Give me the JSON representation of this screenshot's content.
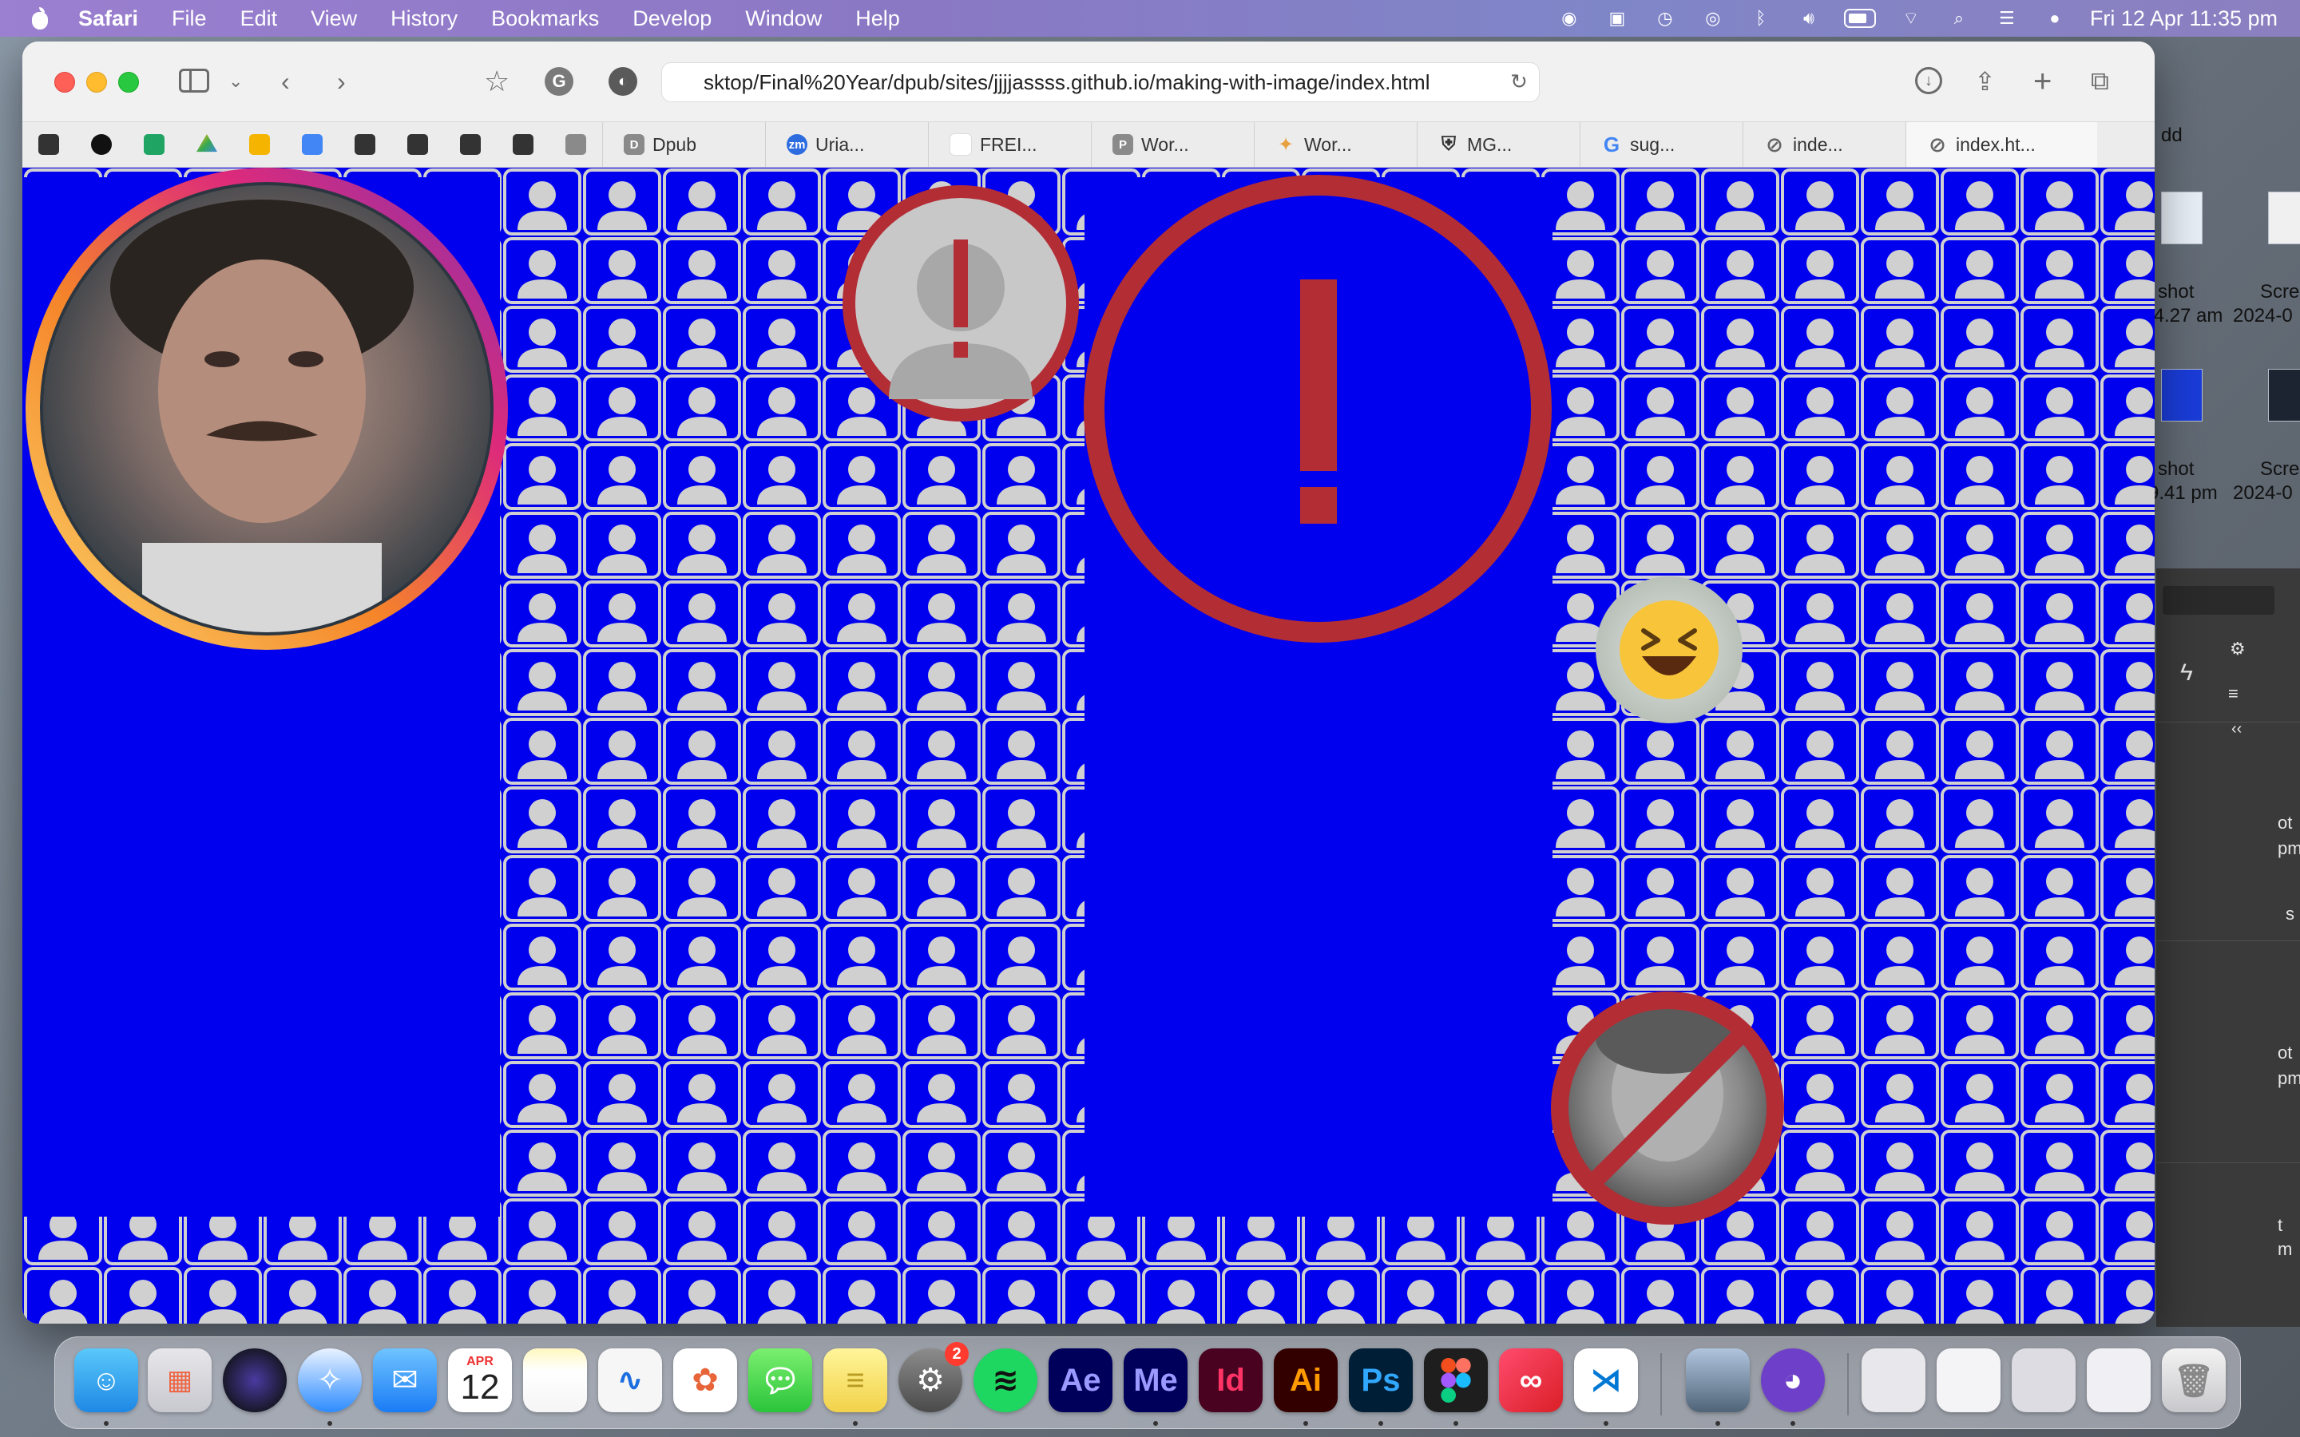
{
  "menubar": {
    "app_name": "Safari",
    "menus": [
      "File",
      "Edit",
      "View",
      "History",
      "Bookmarks",
      "Develop",
      "Window",
      "Help"
    ],
    "clock": "Fri 12 Apr  11:35 pm"
  },
  "browser": {
    "url": "sktop/Final%20Year/dpub/sites/jjjjassss.github.io/making-with-image/index.html",
    "favorites": [
      {
        "label": "Dpub",
        "icon_letter": "D",
        "color": "#8a8a8a"
      },
      {
        "label": "Uria...",
        "icon_letter": "zm",
        "color": "#2d6cdf"
      },
      {
        "label": "FREI...",
        "icon_letter": "",
        "color": "#ffffff"
      },
      {
        "label": "Wor...",
        "icon_letter": "P",
        "color": "#8a8a8a"
      },
      {
        "label": "Wor...",
        "icon_letter": "✦",
        "color": "#e8a040"
      },
      {
        "label": "MG...",
        "icon_letter": "⛨",
        "color": "#333333"
      },
      {
        "label": "sug...",
        "icon_letter": "G",
        "color": "#4285f4"
      },
      {
        "label": "inde...",
        "icon_letter": "⊘",
        "color": "#666666"
      },
      {
        "label": "index.ht...",
        "icon_letter": "⊘",
        "color": "#666666"
      }
    ]
  },
  "page": {
    "background_color": "#0000ee",
    "icon_color": "#d0d0d0",
    "warning_color": "#b32d35"
  },
  "desktop": {
    "file_labels": [
      "dd",
      "shot",
      ".4.27 am",
      "Scre",
      "2024-0",
      "shot",
      "9.41 pm",
      "Scre",
      "2024-0"
    ],
    "panel_labels": [
      "ot",
      "pm",
      "s",
      "ot",
      "pm",
      "t",
      "m"
    ]
  },
  "dock": {
    "calendar_month": "APR",
    "calendar_day": "12",
    "settings_badge": "2",
    "apps": [
      "Ae",
      "Me",
      "Id",
      "Ai",
      "Ps"
    ]
  }
}
